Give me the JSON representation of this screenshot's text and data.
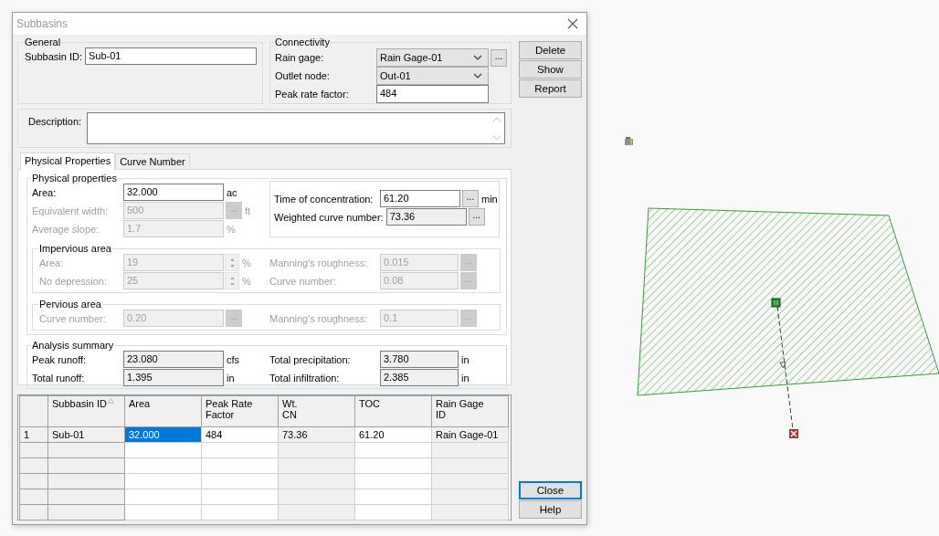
{
  "window": {
    "title": "Subbasins"
  },
  "general": {
    "legend": "General",
    "fields": [
      {
        "label": "Subbasin ID:",
        "value": "Sub-01",
        "disabled": false,
        "readonly": false
      }
    ]
  },
  "connectivity": {
    "legend": "Connectivity",
    "fields": [
      {
        "kind": "dropdown",
        "label": "Rain gage:",
        "value": "Rain Gage-01",
        "browse": "...",
        "disabled": false
      },
      {
        "kind": "dropdown",
        "label": "Outlet node:",
        "value": "Out-01",
        "disabled": false
      },
      {
        "kind": "text",
        "label": "Peak rate factor:",
        "value": "484",
        "disabled": false,
        "readonly": false
      }
    ]
  },
  "description": {
    "label": "Description:"
  },
  "tabs": [
    {
      "label": "Physical Properties",
      "selected": true
    },
    {
      "label": "Curve Number",
      "selected": false
    }
  ],
  "physical_properties": {
    "legend": "Physical properties",
    "fields": [
      {
        "label": "Area:",
        "value": "32.000",
        "unit": "ac",
        "disabled": false,
        "readonly": false
      },
      {
        "label": "Equivalent width:",
        "value": "500",
        "browse": "...",
        "unit": "ft",
        "disabled": true
      },
      {
        "label": "Average slope:",
        "value": "1.7",
        "unit": "%",
        "disabled": true
      }
    ],
    "concentration_fields": [
      {
        "label": "Time of concentration:",
        "value": "61.20",
        "browse": "...",
        "unit": "min",
        "disabled": false,
        "readonly": false
      },
      {
        "label": "Weighted curve number:",
        "value": "73.36",
        "browse": "...",
        "disabled": false,
        "readonly": true
      }
    ]
  },
  "impervious_area": {
    "legend": "Impervious area",
    "left": [
      {
        "kind": "spin",
        "label": "Area:",
        "value": "19",
        "unit": "%",
        "disabled": true
      },
      {
        "kind": "spin",
        "label": "No depression:",
        "value": "25",
        "unit": "%",
        "disabled": true
      }
    ],
    "right": [
      {
        "label": "Manning's roughness:",
        "value": "0.015",
        "browse": "...",
        "disabled": true
      },
      {
        "label": "Curve number:",
        "value": "0.08",
        "browse": "...",
        "disabled": true
      }
    ]
  },
  "pervious_area": {
    "legend": "Pervious area",
    "left": [
      {
        "label": "Curve number:",
        "value": "0.20",
        "browse": "...",
        "disabled": true
      }
    ],
    "right": [
      {
        "label": "Manning's roughness:",
        "value": "0.1",
        "browse": "...",
        "disabled": true
      }
    ]
  },
  "analysis_summary": {
    "legend": "Analysis summary",
    "left": [
      {
        "label": "Peak runoff:",
        "value": "23.080",
        "unit": "cfs",
        "disabled": false,
        "readonly": true
      },
      {
        "label": "Total runoff:",
        "value": "1.395",
        "unit": "in",
        "disabled": false,
        "readonly": true
      }
    ],
    "right": [
      {
        "label": "Total precipitation:",
        "value": "3.780",
        "unit": "in",
        "disabled": false,
        "readonly": true
      },
      {
        "label": "Total infiltration:",
        "value": "2.385",
        "unit": "in",
        "disabled": false,
        "readonly": true
      }
    ]
  },
  "grid": {
    "columns": [
      {
        "kind": "header",
        "sorted": false
      },
      {
        "kind": "header",
        "label": "Subbasin ID",
        "sorted": true
      },
      {
        "kind": "editable",
        "label": "Area",
        "sorted": false
      },
      {
        "kind": "editable",
        "label": "Peak Rate\nFactor",
        "sorted": false
      },
      {
        "kind": "readonly",
        "label": "Wt.\nCN",
        "sorted": false
      },
      {
        "kind": "editable",
        "label": "TOC",
        "sorted": false
      },
      {
        "kind": "readonly",
        "label": "Rain Gage\nID",
        "sorted": false
      }
    ],
    "rows": [
      {
        "kind": "data",
        "cells": [
          {
            "text": "1",
            "selected": false
          },
          {
            "text": "Sub-01",
            "selected": false
          },
          {
            "text": "32.000",
            "selected": true
          },
          {
            "text": "484",
            "selected": false
          },
          {
            "text": "73.36",
            "selected": false
          },
          {
            "text": "61.20",
            "selected": false
          },
          {
            "text": "Rain Gage-01",
            "selected": false
          }
        ]
      },
      {
        "kind": "blank"
      },
      {
        "kind": "blank"
      },
      {
        "kind": "blank"
      },
      {
        "kind": "blank"
      },
      {
        "kind": "blank"
      }
    ]
  },
  "top_buttons": [
    {
      "label": "Delete",
      "default": false
    },
    {
      "label": "Show",
      "default": false
    },
    {
      "label": "Report",
      "default": false
    }
  ],
  "bottom_buttons": [
    {
      "label": "Close",
      "default": true
    },
    {
      "label": "Help",
      "default": false
    }
  ]
}
